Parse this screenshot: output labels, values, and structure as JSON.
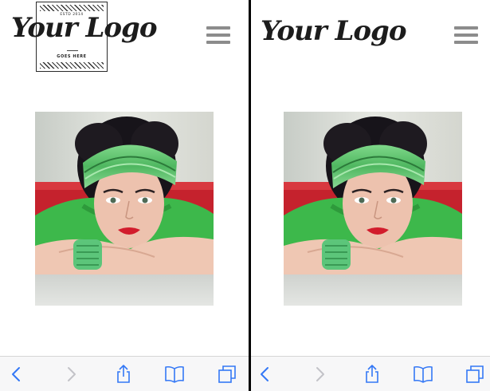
{
  "screens": [
    {
      "id": "left",
      "logo": {
        "text": "Your Logo",
        "badge": true,
        "badge_top": "ESTD 2014",
        "badge_bottom": "GOES HERE"
      },
      "photo_desc": "woman with green headband"
    },
    {
      "id": "right",
      "logo": {
        "text": "Your Logo",
        "badge": false
      },
      "photo_desc": "woman with green headband"
    }
  ],
  "toolbar": {
    "icons": [
      "back-icon",
      "forward-icon",
      "share-icon",
      "bookmarks-icon",
      "tabs-icon"
    ],
    "color_active": "#3478f6",
    "color_disabled": "#c3c3c8"
  },
  "colors": {
    "menu": "#8c8c8c",
    "headband": "#5bbf6a",
    "shirt": "#3fb84a",
    "sofa": "#c8242e"
  }
}
